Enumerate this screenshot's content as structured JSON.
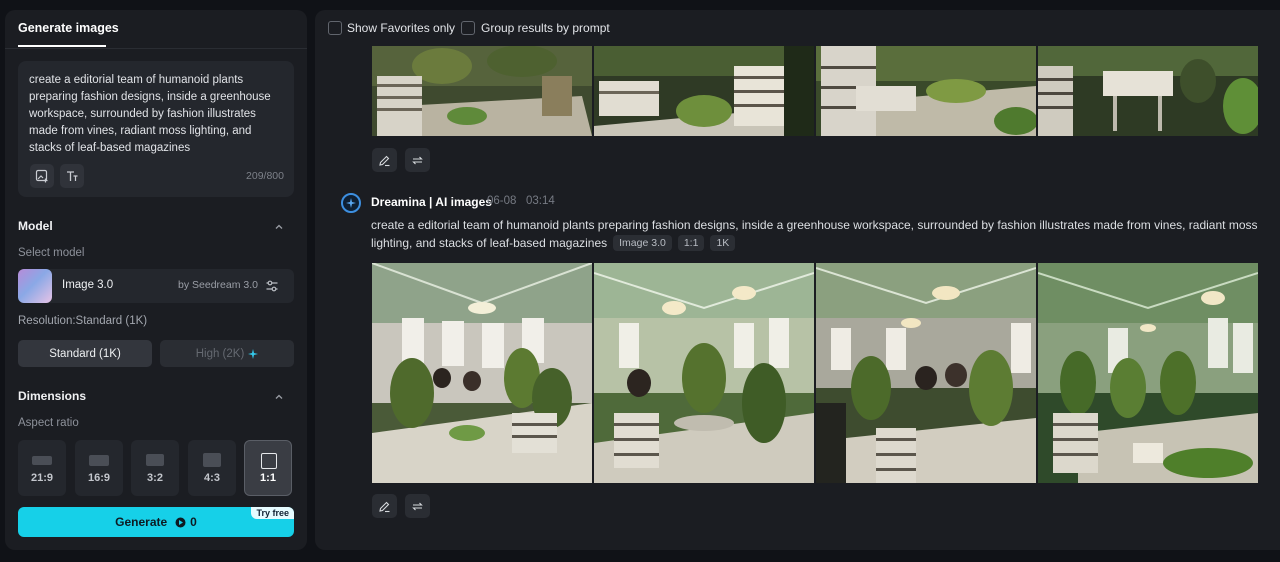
{
  "sidebar": {
    "tab_label": "Generate images",
    "prompt_text": "create a editorial team of humanoid plants preparing fashion designs, inside a greenhouse workspace, surrounded by fashion illustrates made from vines, radiant moss lighting, and stacks of leaf-based magazines",
    "char_count": "209/800",
    "model_section_title": "Model",
    "select_model_label": "Select model",
    "model_name": "Image 3.0",
    "model_by": "by Seedream 3.0",
    "resolution_label": "Resolution:Standard (1K)",
    "res_standard": "Standard (1K)",
    "res_high": "High (2K)",
    "dimensions_title": "Dimensions",
    "aspect_ratio_label": "Aspect ratio",
    "ratios": [
      "21:9",
      "16:9",
      "3:2",
      "4:3",
      "1:1"
    ],
    "selected_ratio": "1:1",
    "generate_label": "Generate",
    "generate_cost": "0",
    "try_free_label": "Try free"
  },
  "results": {
    "show_favorites_label": "Show Favorites only",
    "group_by_prompt_label": "Group results by prompt",
    "bot_name": "Dreamina | AI images",
    "date": "06-08",
    "time": "03:14",
    "prompt": "create a editorial team of humanoid plants preparing fashion designs, inside a greenhouse workspace, surrounded by fashion illustrates made from vines, radiant moss lighting, and stacks of leaf-based magazines",
    "chips": [
      "Image 3.0",
      "1:1",
      "1K"
    ]
  },
  "colors": {
    "accent": "#16d0e8",
    "panel_bg": "#1b1d22",
    "page_bg": "#101217"
  }
}
